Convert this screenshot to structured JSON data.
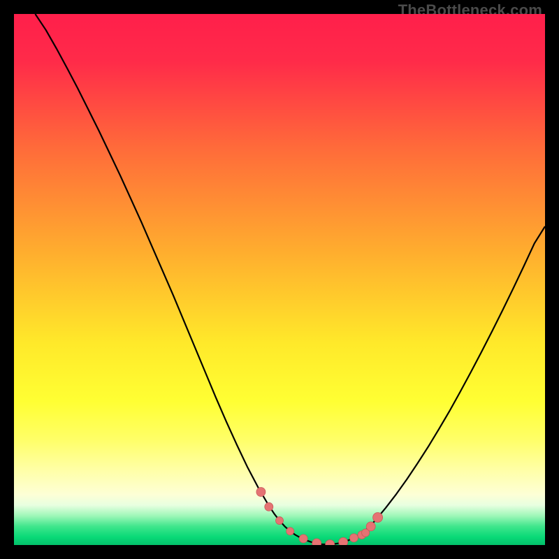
{
  "watermark": "TheBottleneck.com",
  "colors": {
    "frame": "#000000",
    "curve": "#000000",
    "marker_fill": "#e57373",
    "marker_stroke": "#c85a5a",
    "gradient_stops": [
      {
        "offset": 0.0,
        "color": "#ff1f4b"
      },
      {
        "offset": 0.09,
        "color": "#ff2b49"
      },
      {
        "offset": 0.25,
        "color": "#ff6a3a"
      },
      {
        "offset": 0.45,
        "color": "#ffae2e"
      },
      {
        "offset": 0.62,
        "color": "#ffe92a"
      },
      {
        "offset": 0.73,
        "color": "#ffff33"
      },
      {
        "offset": 0.8,
        "color": "#ffff66"
      },
      {
        "offset": 0.86,
        "color": "#ffffa8"
      },
      {
        "offset": 0.905,
        "color": "#fdffd6"
      },
      {
        "offset": 0.925,
        "color": "#e8ffe0"
      },
      {
        "offset": 0.945,
        "color": "#9ef7b8"
      },
      {
        "offset": 0.965,
        "color": "#3fe68c"
      },
      {
        "offset": 0.985,
        "color": "#09d977"
      },
      {
        "offset": 1.0,
        "color": "#03c06a"
      }
    ]
  },
  "chart_data": {
    "type": "line",
    "title": "",
    "xlabel": "",
    "ylabel": "",
    "xlim": [
      0,
      100
    ],
    "ylim": [
      0,
      100
    ],
    "x": [
      4,
      6,
      8,
      10,
      12,
      14,
      16,
      18,
      20,
      22,
      24,
      26,
      28,
      30,
      32,
      34,
      36,
      38,
      40,
      42,
      44,
      46,
      48,
      49,
      50,
      51,
      52,
      53,
      54,
      55,
      56,
      57,
      58,
      59,
      60,
      61,
      62,
      63,
      64,
      65,
      66,
      67,
      68,
      70,
      72,
      74,
      76,
      78,
      80,
      82,
      84,
      86,
      88,
      90,
      92,
      94,
      96,
      98,
      100
    ],
    "values": [
      100,
      97,
      93.5,
      89.8,
      86,
      82,
      78,
      73.8,
      69.6,
      65.2,
      60.8,
      56.2,
      51.6,
      47,
      42.2,
      37.4,
      32.6,
      27.8,
      23.2,
      18.8,
      14.6,
      10.8,
      7.4,
      5.9,
      4.6,
      3.5,
      2.6,
      1.9,
      1.35,
      0.9,
      0.55,
      0.3,
      0.15,
      0.12,
      0.15,
      0.3,
      0.55,
      0.9,
      1.35,
      1.9,
      2.6,
      3.5,
      4.6,
      7.0,
      9.6,
      12.4,
      15.4,
      18.5,
      21.8,
      25.2,
      28.8,
      32.5,
      36.3,
      40.2,
      44.2,
      48.3,
      52.5,
      56.8,
      60.0
    ],
    "markers": {
      "x": [
        46.5,
        48.0,
        50.0,
        52.0,
        54.5,
        57.0,
        59.5,
        62.0,
        64.0,
        65.5,
        66.2,
        67.2,
        68.5
      ],
      "y": [
        10.0,
        7.2,
        4.6,
        2.6,
        1.2,
        0.35,
        0.12,
        0.55,
        1.35,
        1.9,
        2.3,
        3.5,
        5.2
      ],
      "r": [
        6.5,
        6.0,
        5.5,
        5.5,
        6.0,
        6.5,
        6.5,
        6.5,
        6.0,
        5.8,
        5.6,
        6.5,
        7.0
      ]
    }
  }
}
